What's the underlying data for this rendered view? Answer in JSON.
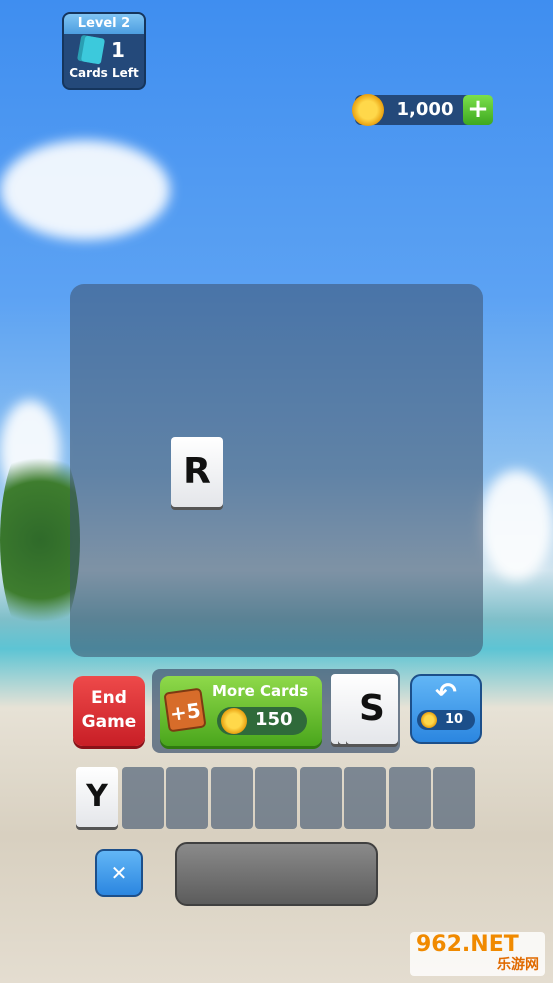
{
  "hud": {
    "level": "Level 2",
    "cards_left_count": "1",
    "cards_left_label": "Cards Left",
    "coins": "1,000",
    "add_coins": "+"
  },
  "board": {
    "tiles": [
      "R"
    ]
  },
  "controls": {
    "end_game_line1": "End",
    "end_game_line2": "Game",
    "more_cards_bonus": "+5",
    "more_cards_label": "More Cards",
    "more_cards_price": "150",
    "deck_top": "S",
    "undo_icon": "↶",
    "undo_price": "10",
    "clear_icon": "✕"
  },
  "word_slots": [
    "Y",
    "",
    "",
    "",
    "",
    "",
    "",
    "",
    ""
  ],
  "watermark": {
    "text": "962.NET",
    "sub": "乐游网"
  }
}
